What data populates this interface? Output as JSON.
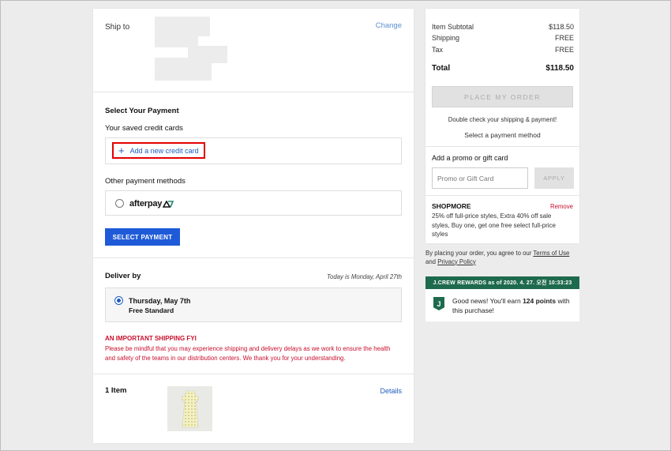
{
  "ship_to": {
    "label": "Ship to",
    "change_link": "Change"
  },
  "payment": {
    "heading": "Select Your Payment",
    "saved_cards_label": "Your saved credit cards",
    "add_card": "Add a new credit card",
    "other_methods_label": "Other payment methods",
    "afterpay_label": "afterpay",
    "select_button": "SELECT PAYMENT"
  },
  "delivery": {
    "heading": "Deliver by",
    "today": "Today is Monday, April 27th",
    "date": "Thursday, May 7th",
    "method": "Free Standard",
    "warning_title": "AN IMPORTANT SHIPPING FYI",
    "warning_text": "Please be mindful that you may experience shipping and delivery delays as we work to ensure the health and safety of the teams in our distribution centers. We thank you for your understanding."
  },
  "items": {
    "count_label": "1 Item",
    "details_link": "Details"
  },
  "summary": {
    "subtotal_label": "Item Subtotal",
    "subtotal_value": "$118.50",
    "shipping_label": "Shipping",
    "shipping_value": "FREE",
    "tax_label": "Tax",
    "tax_value": "FREE",
    "total_label": "Total",
    "total_value": "$118.50",
    "place_order": "PLACE MY ORDER",
    "double_check": "Double check your shipping & payment!",
    "select_payment_method": "Select a payment method"
  },
  "promo": {
    "heading": "Add a promo or gift card",
    "placeholder": "Promo or Gift Card",
    "apply": "APPLY",
    "code": "SHOPMORE",
    "remove": "Remove",
    "description": "25% off full-price styles, Extra 40% off sale styles, Buy one, get one free select full-price styles"
  },
  "terms": {
    "prefix": "By placing your order, you agree to our",
    "terms_link": "Terms of Use",
    "and": "and",
    "privacy_link": "Privacy Policy"
  },
  "rewards": {
    "bar_text": "J.CREW REWARDS as of 2020. 4. 27. 오전 10:33:23",
    "icon_letter": "J",
    "message_prefix": "Good news! You'll earn",
    "points": "124 points",
    "message_suffix": "with this purchase!"
  },
  "colors": {
    "link_blue": "#1f5bbf",
    "primary_button": "#1f5bd8",
    "warning_red": "#c8102e",
    "rewards_green": "#1e6a4e"
  }
}
